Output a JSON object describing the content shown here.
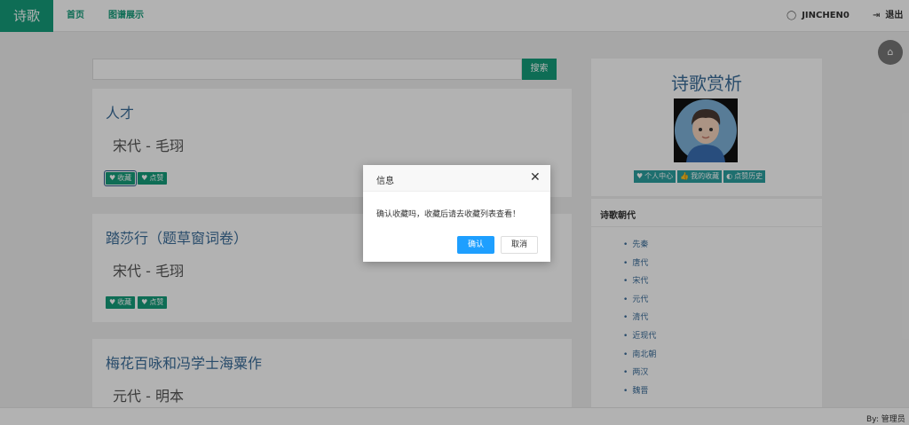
{
  "navbar": {
    "brand": "诗歌",
    "links": [
      "首页",
      "图谱展示"
    ],
    "user": "JINCHEN0",
    "logout": "退出"
  },
  "search": {
    "button": "搜索",
    "placeholder": ""
  },
  "poems": [
    {
      "title": "人才",
      "meta": "宋代 - 毛珝",
      "collect": "收藏",
      "like": "点赞"
    },
    {
      "title": "踏莎行（题草窗词卷）",
      "meta": "宋代 - 毛珝",
      "collect": "收藏",
      "like": "点赞"
    },
    {
      "title": "梅花百咏和冯学士海粟作",
      "meta": "元代 - 明本"
    }
  ],
  "sidebar": {
    "title": "诗歌赏析",
    "buttons": [
      "个人中心",
      "我的收藏",
      "点赞历史"
    ],
    "dynasty_heading": "诗歌朝代",
    "dynasties": [
      "先秦",
      "唐代",
      "宋代",
      "元代",
      "清代",
      "近现代",
      "南北朝",
      "两汉",
      "魏晋"
    ]
  },
  "footer": {
    "text": "By:  管理员"
  },
  "dialog": {
    "title": "信息",
    "message": "确认收藏吗，收藏后请去收藏列表查看！",
    "confirm": "确认",
    "cancel": "取消"
  },
  "colors": {
    "accent": "#159c7a",
    "link": "#3b6d9a",
    "primary": "#1e9fff"
  }
}
